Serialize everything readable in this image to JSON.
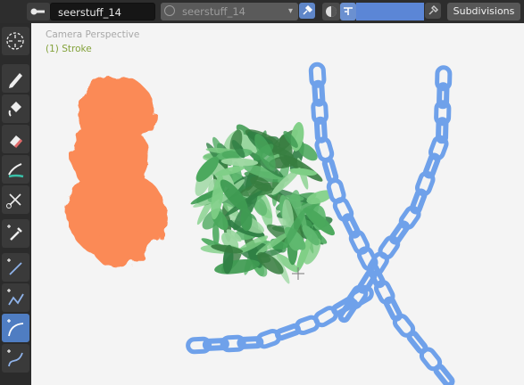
{
  "header": {
    "brush_name": "seerstuff_14",
    "material_name": "seerstuff_14",
    "subdivisions_label": "Subdivisions"
  },
  "viewport": {
    "title": "Camera Perspective",
    "active_object": "(1) Stroke"
  },
  "toolbar": {
    "tools": [
      {
        "name": "cursor-tool",
        "icon": "crosshair-circle-icon"
      },
      {
        "name": "draw-tool",
        "icon": "pencil-icon"
      },
      {
        "name": "fill-tool",
        "icon": "bucket-icon"
      },
      {
        "name": "erase-tool",
        "icon": "eraser-icon"
      },
      {
        "name": "tint-tool",
        "icon": "tint-brush-icon"
      },
      {
        "name": "cutter-tool",
        "icon": "scissors-icon"
      },
      {
        "name": "eyedropper-tool",
        "icon": "eyedropper-icon"
      },
      {
        "name": "line-tool",
        "icon": "line-icon"
      },
      {
        "name": "polyline-tool",
        "icon": "polyline-icon"
      },
      {
        "name": "arc-tool",
        "icon": "arc-icon"
      },
      {
        "name": "curve-tool",
        "icon": "curve-icon"
      }
    ],
    "active_tool": "arc-tool"
  },
  "colors": {
    "accent_blue": "#4f7dc2",
    "chain_blue": "#6fa1ea",
    "stroke_orange": "#fb8a57",
    "foliage_green": "#53a765",
    "object_label_green": "#83a23a"
  }
}
